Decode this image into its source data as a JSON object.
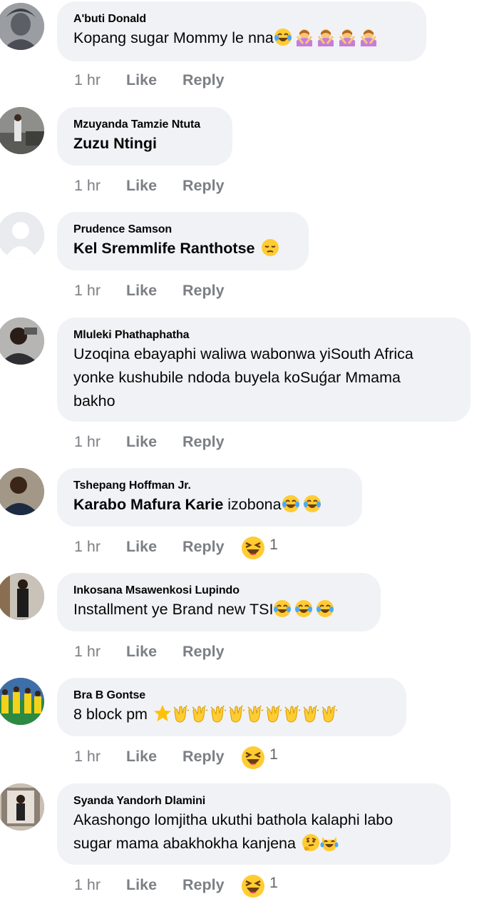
{
  "comments": [
    {
      "name": "A'buti Donald",
      "tag": "",
      "text": "Kopang sugar Mommy le nna",
      "emojis": [
        "laugh-cry",
        "no-gesture",
        "no-gesture",
        "no-gesture",
        "no-gesture"
      ],
      "time": "1 hr",
      "like": "Like",
      "reply": "Reply",
      "reaction_count": ""
    },
    {
      "name": "Mzuyanda Tamzie Ntuta",
      "tag": "Zuzu Ntingi",
      "text": "",
      "emojis": [],
      "time": "1 hr",
      "like": "Like",
      "reply": "Reply",
      "reaction_count": ""
    },
    {
      "name": "Prudence Samson",
      "tag": "Kel Sremmlife Ranthotse",
      "text": "",
      "emojis": [
        "pensive"
      ],
      "time": "1 hr",
      "like": "Like",
      "reply": "Reply",
      "reaction_count": ""
    },
    {
      "name": "Mluleki Phathaphatha",
      "tag": "",
      "text_lines": [
        "Uzoqina ebayaphi waliwa wabonwa yiSouth Africa",
        "yonke kushubile ndoda buyela koSuǵar Mmama",
        "bakho"
      ],
      "emojis": [],
      "time": "1 hr",
      "like": "Like",
      "reply": "Reply",
      "reaction_count": ""
    },
    {
      "name": "Tshepang Hoffman Jr.",
      "tag": "Karabo Mafura Karie",
      "text": " izobona",
      "emojis": [
        "laugh-cry",
        "laugh-cry"
      ],
      "time": "1 hr",
      "like": "Like",
      "reply": "Reply",
      "reaction_count": "1"
    },
    {
      "name": "Inkosana Msawenkosi Lupindo",
      "tag": "",
      "text": "Installment ye Brand new TSI",
      "emojis": [
        "laugh-cry",
        "laugh-cry",
        "laugh-cry"
      ],
      "time": "1 hr",
      "like": "Like",
      "reply": "Reply",
      "reaction_count": ""
    },
    {
      "name": "Bra B Gontse",
      "tag": "",
      "text": "8 block pm",
      "emojis": [
        "star",
        "clap",
        "clap",
        "clap",
        "clap",
        "clap",
        "clap",
        "clap",
        "clap",
        "clap"
      ],
      "time": "1 hr",
      "like": "Like",
      "reply": "Reply",
      "reaction_count": "1"
    },
    {
      "name": "Syanda Yandorh Dlamini",
      "tag": "",
      "text_lines": [
        "Akashongo lomjitha ukuthi bathola kalaphi labo",
        "sugar mama abakhokha kanjena"
      ],
      "emojis": [
        "thinking",
        "cat-laugh"
      ],
      "time": "1 hr",
      "like": "Like",
      "reply": "Reply",
      "reaction_count": "1"
    }
  ],
  "colors": {
    "bubble": "#f0f2f5",
    "action_text": "#7c7f84",
    "text": "#050505"
  },
  "reaction_icon": "haha-squint-face"
}
